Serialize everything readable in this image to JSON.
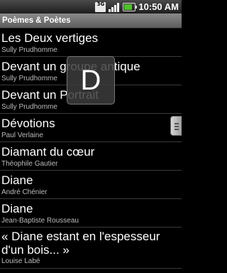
{
  "status_bar": {
    "network_label": "3G",
    "time": "10:50 AM"
  },
  "title": "Poèmes & Poètes",
  "list": [
    {
      "poem": "Les Deux vertiges",
      "poet": "Sully Prudhomme"
    },
    {
      "poem": "Devant un groupe antique",
      "poet": "Sully Prudhomme"
    },
    {
      "poem": "Devant un Portrait",
      "poet": "Sully Prudhomme"
    },
    {
      "poem": "Dévotions",
      "poet": "Paul Verlaine"
    },
    {
      "poem": "Diamant du cœur",
      "poet": "Théophile Gautier"
    },
    {
      "poem": "Diane",
      "poet": "André Chénier"
    },
    {
      "poem": "Diane",
      "poet": "Jean-Baptiste Rousseau"
    },
    {
      "poem": "« Diane estant en l'espesseur d'un bois... »",
      "poet": "Louise Labé"
    }
  ],
  "fast_scroll_letter": "D"
}
